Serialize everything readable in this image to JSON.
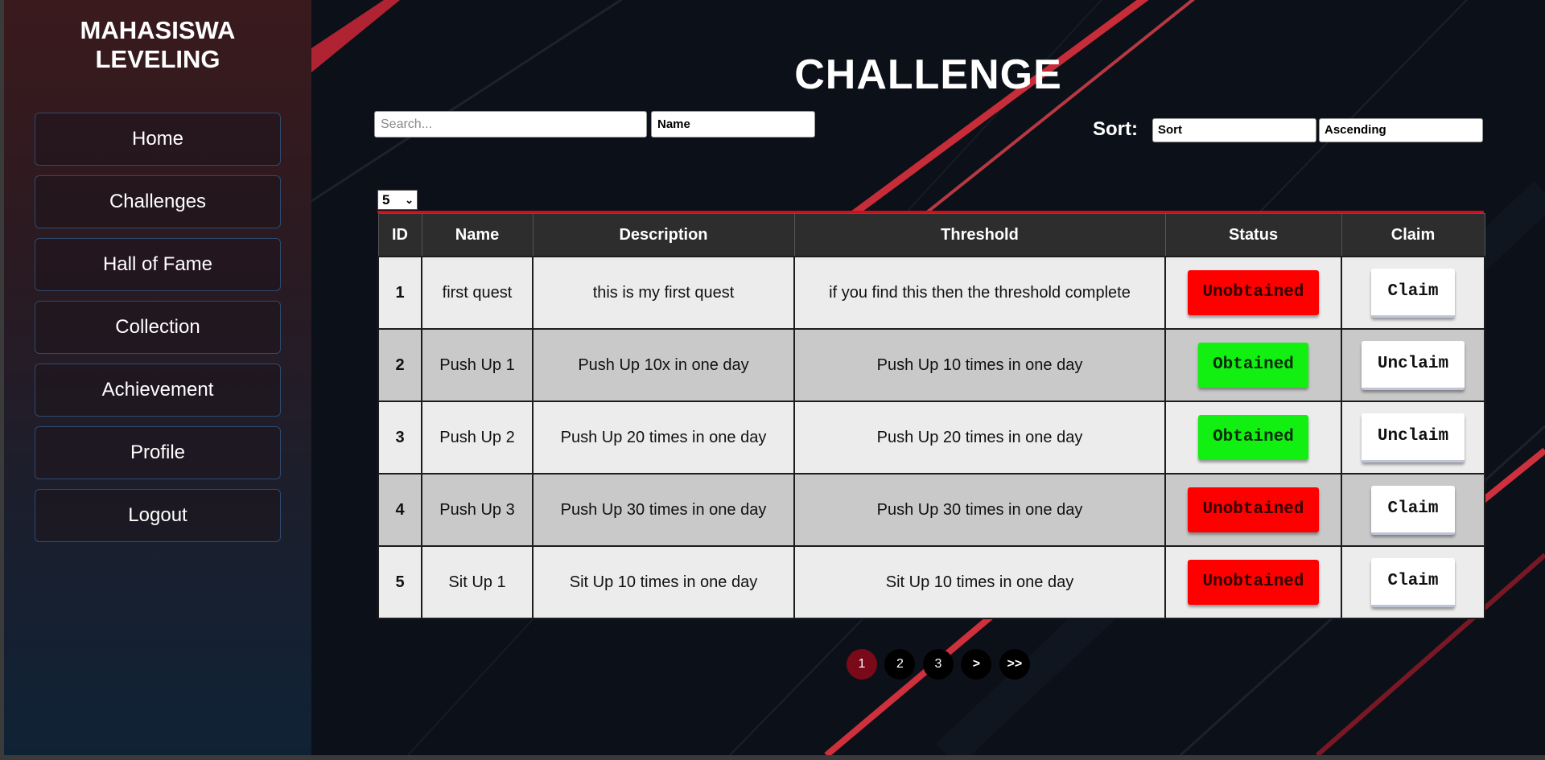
{
  "sidebar": {
    "brand": "MAHASISWA\nLEVELING",
    "items": [
      {
        "label": "Home"
      },
      {
        "label": "Challenges"
      },
      {
        "label": "Hall of Fame"
      },
      {
        "label": "Collection"
      },
      {
        "label": "Achievement"
      },
      {
        "label": "Profile"
      },
      {
        "label": "Logout"
      }
    ]
  },
  "main": {
    "title": "CHALLENGE",
    "search": {
      "placeholder": "Search...",
      "value": ""
    },
    "search_field": "Name",
    "sort": {
      "label": "Sort:",
      "field": "Sort",
      "order": "Ascending"
    },
    "page_size": "5",
    "table": {
      "headers": [
        "ID",
        "Name",
        "Description",
        "Threshold",
        "Status",
        "Claim"
      ],
      "rows": [
        {
          "id": "1",
          "name": "first quest",
          "description": "this is my first quest",
          "threshold": "if you find this then the threshold complete",
          "status": "Unobtained",
          "claim": "Claim"
        },
        {
          "id": "2",
          "name": "Push Up 1",
          "description": "Push Up 10x in one day",
          "threshold": "Push Up 10 times in one day",
          "status": "Obtained",
          "claim": "Unclaim"
        },
        {
          "id": "3",
          "name": "Push Up 2",
          "description": "Push Up 20 times in one day",
          "threshold": "Push Up 20 times in one day",
          "status": "Obtained",
          "claim": "Unclaim"
        },
        {
          "id": "4",
          "name": "Push Up 3",
          "description": "Push Up 30 times in one day",
          "threshold": "Push Up 30 times in one day",
          "status": "Unobtained",
          "claim": "Claim"
        },
        {
          "id": "5",
          "name": "Sit Up 1",
          "description": "Sit Up 10 times in one day",
          "threshold": "Sit Up 10 times in one day",
          "status": "Unobtained",
          "claim": "Claim"
        }
      ]
    },
    "pagination": {
      "pages": [
        "1",
        "2",
        "3"
      ],
      "current": "1",
      "next": ">",
      "last": ">>"
    }
  },
  "colors": {
    "accent_red": "#c8101e",
    "status_obtained": "#12f012",
    "status_unobtained": "#ff0000",
    "active_page": "#7a0a1a"
  }
}
